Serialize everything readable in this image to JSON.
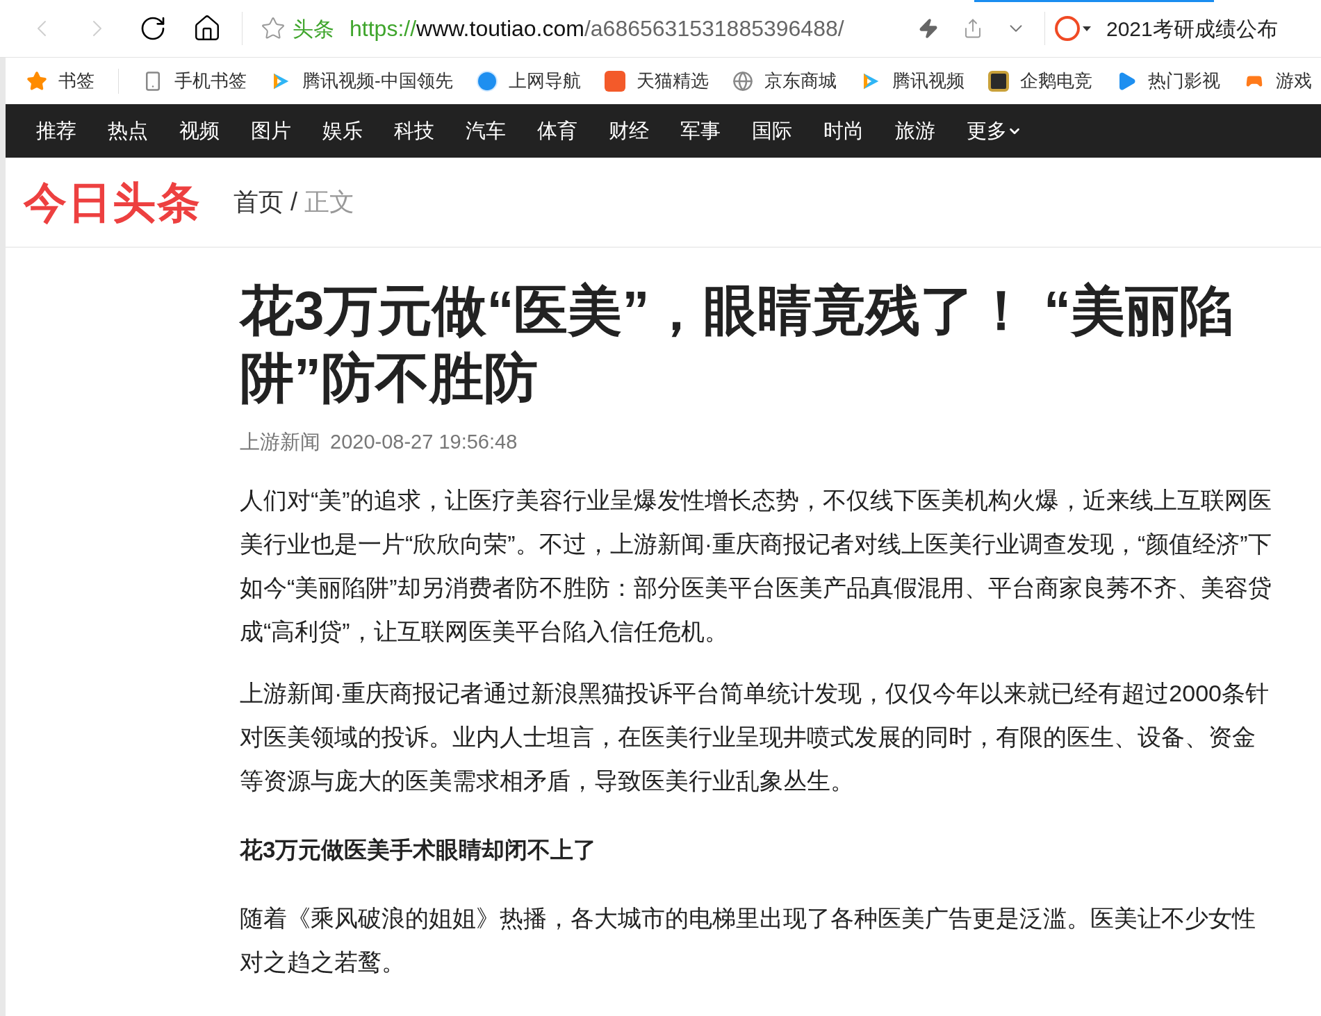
{
  "toolbar": {
    "back": {
      "disabled": true
    },
    "forward": {
      "disabled": true
    },
    "address": {
      "site_label": "头条",
      "scheme": "https://",
      "url": "www.toutiao.com/a6865631531885396488/"
    },
    "search_text": "2021考研成绩公布"
  },
  "bookmarks": [
    {
      "label": "书签"
    },
    {
      "label": "手机书签"
    },
    {
      "label": "腾讯视频-中国领先"
    },
    {
      "label": "上网导航"
    },
    {
      "label": "天猫精选"
    },
    {
      "label": "京东商城"
    },
    {
      "label": "腾讯视频"
    },
    {
      "label": "企鹅电竞"
    },
    {
      "label": "热门影视"
    },
    {
      "label": "游戏"
    }
  ],
  "nav": {
    "items": [
      {
        "label": "推荐",
        "dropdown": false
      },
      {
        "label": "热点",
        "dropdown": false
      },
      {
        "label": "视频",
        "dropdown": false
      },
      {
        "label": "图片",
        "dropdown": false
      },
      {
        "label": "娱乐",
        "dropdown": false
      },
      {
        "label": "科技",
        "dropdown": false
      },
      {
        "label": "汽车",
        "dropdown": false
      },
      {
        "label": "体育",
        "dropdown": false
      },
      {
        "label": "财经",
        "dropdown": false
      },
      {
        "label": "军事",
        "dropdown": false
      },
      {
        "label": "国际",
        "dropdown": false
      },
      {
        "label": "时尚",
        "dropdown": false
      },
      {
        "label": "旅游",
        "dropdown": false
      },
      {
        "label": "更多",
        "dropdown": true
      }
    ]
  },
  "header": {
    "logo": "今日头条",
    "breadcrumb": [
      {
        "label": "首页",
        "current": false
      },
      {
        "label": "正文",
        "current": true
      }
    ],
    "separator": "/"
  },
  "article": {
    "title": "花3万元做“医美”，眼睛竟残了！ “美丽陷阱”防不胜防",
    "source": "上游新闻",
    "time": "2020-08-27 19:56:48",
    "blocks": [
      {
        "kind": "paragraph",
        "text": "人们对“美”的追求，让医疗美容行业呈爆发性增长态势，不仅线下医美机构火爆，近来线上互联网医美行业也是一片“欣欣向荣”。不过，上游新闻·重庆商报记者对线上医美行业调查发现，“颜值经济”下如今“美丽陷阱”却另消费者防不胜防：部分医美平台医美产品真假混用、平台商家良莠不齐、美容贷成“高利贷”，让互联网医美平台陷入信任危机。"
      },
      {
        "kind": "paragraph",
        "text": "上游新闻·重庆商报记者通过新浪黑猫投诉平台简单统计发现，仅仅今年以来就已经有超过2000条针对医美领域的投诉。业内人士坦言，在医美行业呈现井喷式发展的同时，有限的医生、设备、资金等资源与庞大的医美需求相矛盾，导致医美行业乱象丛生。"
      },
      {
        "kind": "heading",
        "text": "花3万元做医美手术眼睛却闭不上了"
      },
      {
        "kind": "paragraph",
        "text": "随着《乘风破浪的姐姐》热播，各大城市的电梯里出现了各种医美广告更是泛滥。医美让不少女性对之趋之若鹜。"
      }
    ]
  }
}
